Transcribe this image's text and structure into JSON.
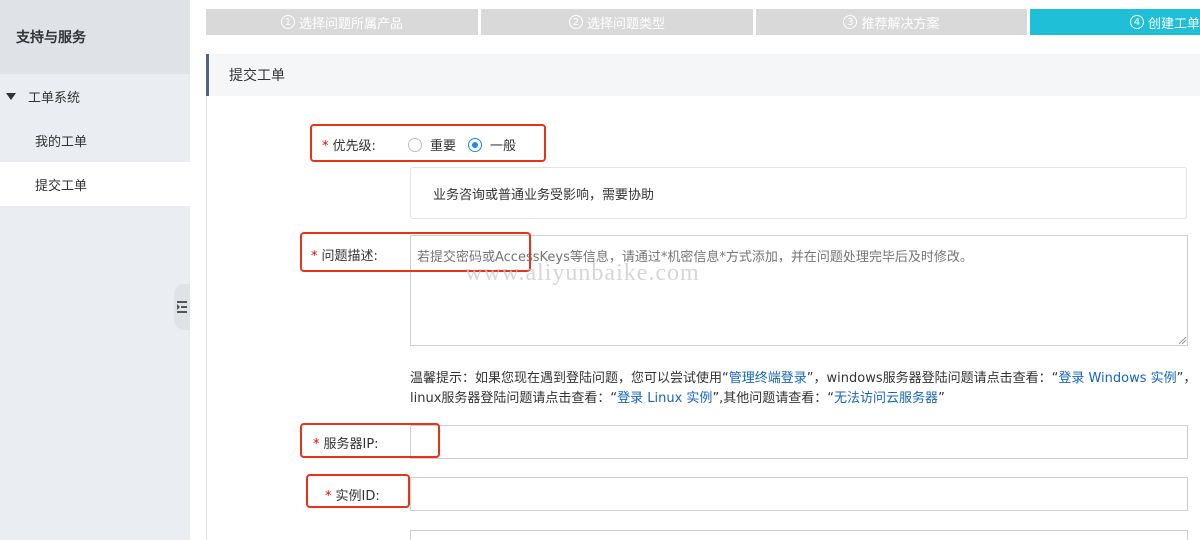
{
  "sidebar": {
    "title": "支持与服务",
    "group": "工单系统",
    "items": [
      {
        "label": "我的工单"
      },
      {
        "label": "提交工单"
      }
    ]
  },
  "steps": [
    {
      "num": "1",
      "label": "选择问题所属产品"
    },
    {
      "num": "2",
      "label": "选择问题类型"
    },
    {
      "num": "3",
      "label": "推荐解决方案"
    },
    {
      "num": "4",
      "label": "创建工单"
    }
  ],
  "panel": {
    "title": "提交工单"
  },
  "form": {
    "required_mark": "*",
    "priority": {
      "label": "优先级:",
      "options": [
        {
          "label": "重要",
          "selected": false
        },
        {
          "label": "一般",
          "selected": true
        }
      ],
      "description": "业务咨询或普通业务受影响，需要协助"
    },
    "description": {
      "label": "问题描述:",
      "placeholder": "若提交密码或AccessKeys等信息，请通过*机密信息*方式添加，并在问题处理完毕后及时修改。",
      "value": ""
    },
    "tip": {
      "part1": "温馨提示：如果您现在遇到登陆问题，您可以尝试使用“",
      "link1": "管理终端登录",
      "part2": "”，windows服务器登陆问题请点击查看：“",
      "link2": "登录 Windows 实例",
      "part3": "”，",
      "part4": "linux服务器登陆问题请点击查看：“",
      "link3": "登录 Linux 实例",
      "part5": "”,其他问题请查看：“",
      "link4": "无法访问云服务器",
      "part6": "”"
    },
    "server_ip": {
      "label": "服务器IP:",
      "value": ""
    },
    "instance_id": {
      "label": "实例ID:",
      "value": ""
    }
  },
  "watermark": "www.aliyunbaike.com",
  "colors": {
    "step_active": "#1fbfd8",
    "step_inactive": "#d9d9d9",
    "highlight": "#e8331b",
    "link": "#1565c0",
    "radio_checked": "#1e88e5"
  }
}
